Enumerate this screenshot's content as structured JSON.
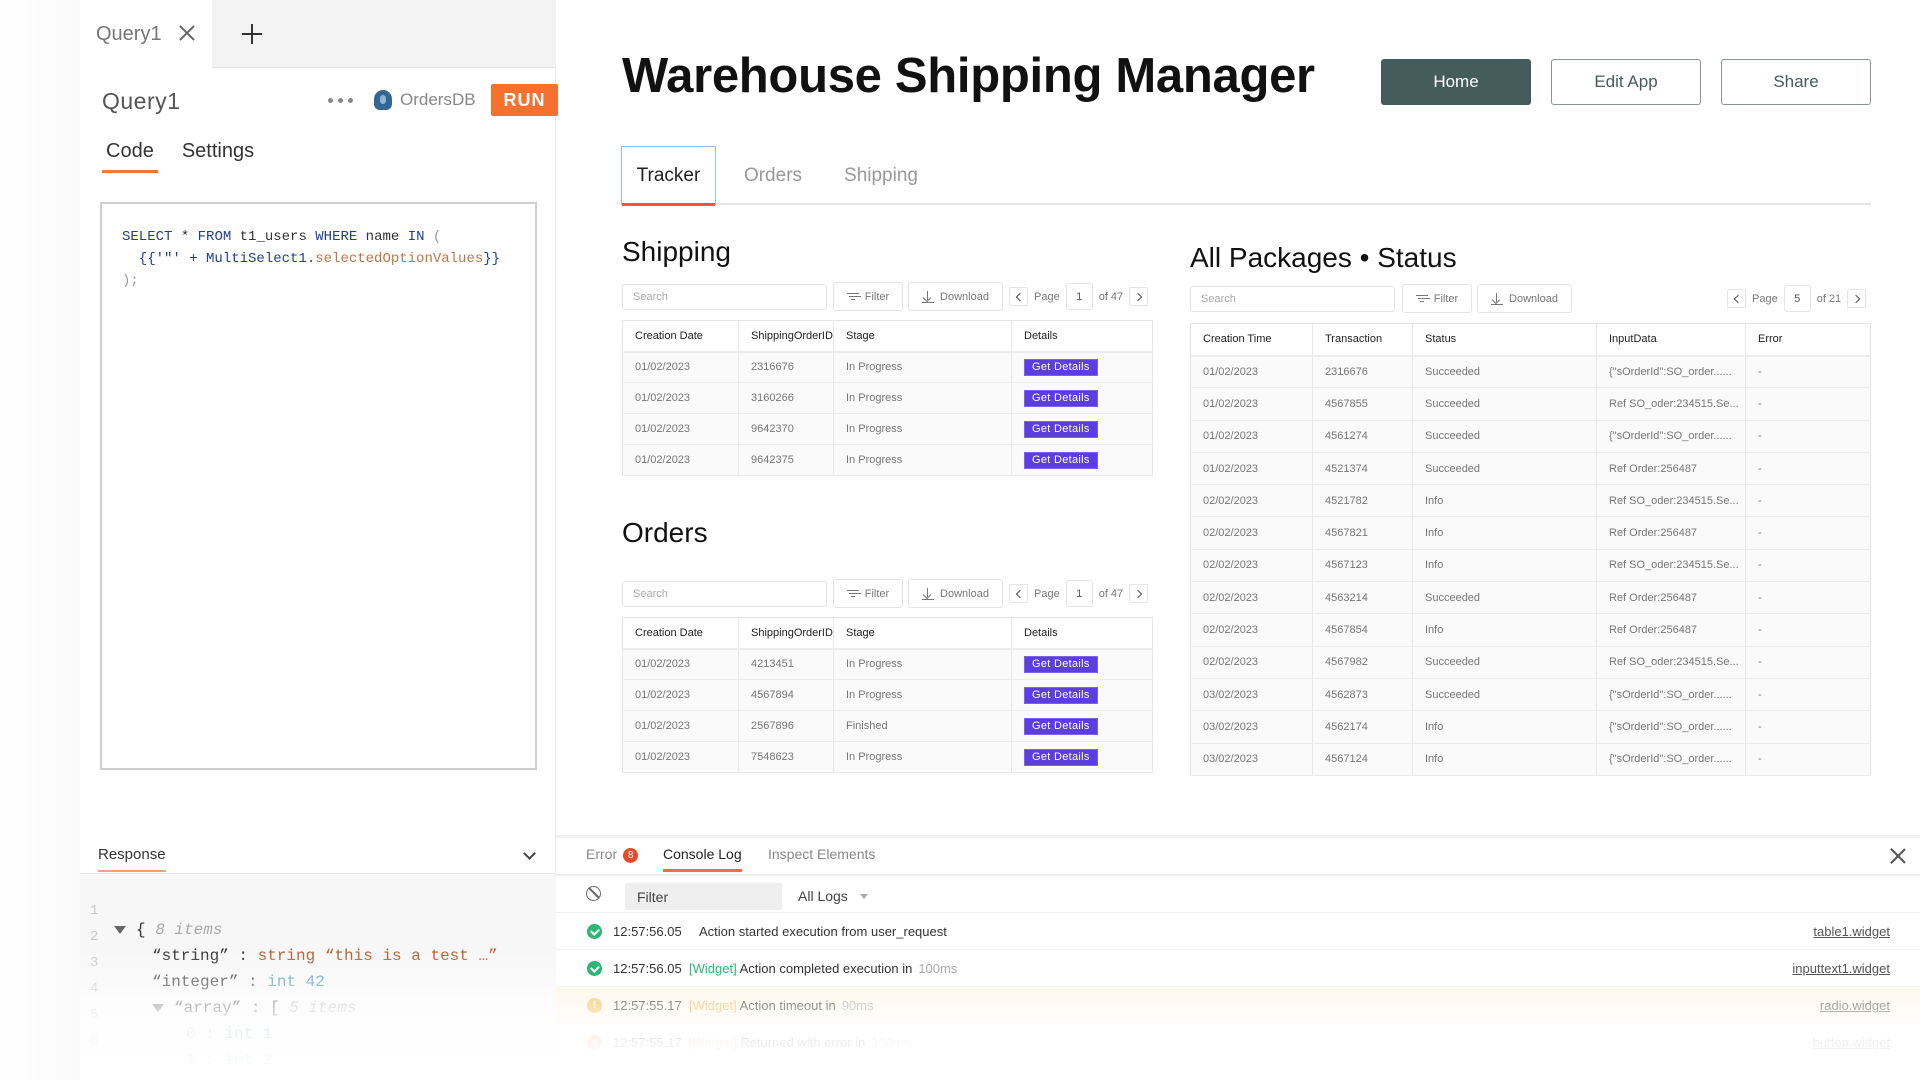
{
  "query_panel": {
    "tab_label": "Query1",
    "title": "Query1",
    "datasource": "OrdersDB",
    "run_label": "RUN",
    "subtabs": [
      "Code",
      "Settings"
    ],
    "code_lines": [
      {
        "kw1": "SELECT",
        "t1": " * ",
        "kw2": "FROM",
        "t2": " t1_users ",
        "kw3": "WHERE",
        "t3": " name ",
        "kw4": "IN",
        "p1": " ("
      },
      {
        "pre": "  {{'\"' + MultiSelect1.",
        "prop": "selectedOptionValues",
        "post": "}}"
      },
      {
        "p": ");"
      }
    ],
    "response": {
      "title": "Response",
      "lines": [
        {
          "n": "1",
          "open": "{",
          "meta": "8 items"
        },
        {
          "n": "2",
          "key": "“string”",
          "type": "string",
          "value": "“this is a test …”"
        },
        {
          "n": "3",
          "key": "“integer”",
          "type": "int",
          "value": "42"
        },
        {
          "n": "4",
          "key": "“array”",
          "open": "[",
          "meta": "5 items"
        },
        {
          "n": "5",
          "idx": "0",
          "type": "int",
          "value": "1"
        },
        {
          "n": "6",
          "idx": "1",
          "type": "int",
          "value": "2"
        }
      ]
    }
  },
  "app": {
    "title": "Warehouse Shipping Manager",
    "buttons": {
      "home": "Home",
      "edit": "Edit App",
      "share": "Share"
    },
    "tabs": [
      "Tracker",
      "Orders",
      "Shipping"
    ],
    "active_tab": "Tracker",
    "accent_color": "#5b3de0",
    "toolbar": {
      "search_placeholder": "Search",
      "filter": "Filter",
      "download": "Download",
      "page": "Page"
    },
    "shipping": {
      "title": "Shipping",
      "page": "1",
      "of": "of 47",
      "columns": [
        "Creation Date",
        "ShippingOrderID",
        "Stage",
        "Details"
      ],
      "button_label": "Get Details",
      "rows": [
        [
          "01/02/2023",
          "2316676",
          "In Progress"
        ],
        [
          "01/02/2023",
          "3160266",
          "In Progress"
        ],
        [
          "01/02/2023",
          "9642370",
          "In Progress"
        ],
        [
          "01/02/2023",
          "9642375",
          "In Progress"
        ]
      ]
    },
    "orders": {
      "title": "Orders",
      "page": "1",
      "of": "of 47",
      "columns": [
        "Creation Date",
        "ShippingOrderID",
        "Stage",
        "Details"
      ],
      "button_label": "Get Details",
      "rows": [
        [
          "01/02/2023",
          "4213451",
          "In Progress"
        ],
        [
          "01/02/2023",
          "4567894",
          "In Progress"
        ],
        [
          "01/02/2023",
          "2567896",
          "Finished"
        ],
        [
          "01/02/2023",
          "7548623",
          "In Progress"
        ]
      ]
    },
    "packages": {
      "title": "All Packages • Status",
      "page": "5",
      "of": "of 21",
      "columns": [
        "Creation Time",
        "Transaction",
        "Status",
        "InputData",
        "Error"
      ],
      "rows": [
        [
          "01/02/2023",
          "2316676",
          "Succeeded",
          "{\"sOrderId\":SO_order......",
          "-"
        ],
        [
          "01/02/2023",
          "4567855",
          "Succeeded",
          "Ref SO_oder:234515.Se...",
          "-"
        ],
        [
          "01/02/2023",
          "4561274",
          "Succeeded",
          "{\"sOrderId\":SO_order......",
          "-"
        ],
        [
          "01/02/2023",
          "4521374",
          "Succeeded",
          "Ref Order:256487",
          "-"
        ],
        [
          "02/02/2023",
          "4521782",
          "Info",
          "Ref SO_oder:234515.Se...",
          "-"
        ],
        [
          "02/02/2023",
          "4567821",
          "Info",
          "Ref Order:256487",
          "-"
        ],
        [
          "02/02/2023",
          "4567123",
          "Info",
          "Ref SO_oder:234515.Se...",
          "-"
        ],
        [
          "02/02/2023",
          "4563214",
          "Succeeded",
          "Ref Order:256487",
          "-"
        ],
        [
          "02/02/2023",
          "4567854",
          "Info",
          "Ref Order:256487",
          "-"
        ],
        [
          "02/02/2023",
          "4567982",
          "Succeeded",
          "Ref SO_oder:234515.Se...",
          "-"
        ],
        [
          "03/02/2023",
          "4562873",
          "Succeeded",
          "{\"sOrderId\":SO_order......",
          "-"
        ],
        [
          "03/02/2023",
          "4562174",
          "Info",
          "{\"sOrderId\":SO_order......",
          "-"
        ],
        [
          "03/02/2023",
          "4567124",
          "Info",
          "{\"sOrderId\":SO_order......",
          "-"
        ]
      ]
    }
  },
  "console": {
    "tabs": {
      "error": "Error",
      "console": "Console Log",
      "inspect": "Inspect Elements"
    },
    "error_count": "8",
    "filter_placeholder": "Filter",
    "level": "All Logs",
    "logs": [
      {
        "level": "ok",
        "time": "12:57:56.05",
        "tag": "",
        "message": "Action started execution from user_request",
        "duration": "",
        "source": "table1.widget"
      },
      {
        "level": "ok",
        "time": "12:57:56.05",
        "tag": "[Widget]",
        "message": "Action completed execution in",
        "duration": "100ms",
        "source": "inputtext1.widget"
      },
      {
        "level": "warn",
        "time": "12:57:55.17",
        "tag": "[Widget]",
        "message": "Action timeout in",
        "duration": "90ms",
        "source": "radio.widget"
      },
      {
        "level": "err",
        "time": "12:57:55.17",
        "tag": "[Widget]",
        "message": "Returned with error in",
        "duration": "100ms",
        "source": "button.widget"
      }
    ]
  }
}
